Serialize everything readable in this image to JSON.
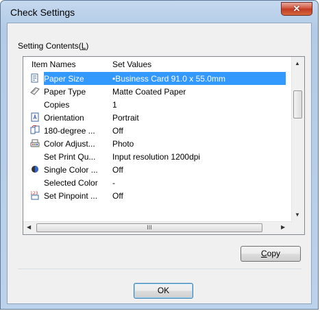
{
  "window": {
    "title": "Check Settings",
    "close_glyph": "✕"
  },
  "group": {
    "label_prefix": "Setting Contents(",
    "label_key": "L",
    "label_suffix": ")"
  },
  "list": {
    "columns": {
      "name": "Item Names",
      "value": "Set Values"
    },
    "rows": [
      {
        "icon": "paper-size-icon",
        "name": "Paper Size",
        "value": "•Business Card 91.0 x 55.0mm",
        "selected": true
      },
      {
        "icon": "paper-type-icon",
        "name": "Paper Type",
        "value": "Matte Coated Paper"
      },
      {
        "icon": "",
        "name": "Copies",
        "value": "1"
      },
      {
        "icon": "orientation-icon",
        "name": "Orientation",
        "value": "Portrait"
      },
      {
        "icon": "rotate-180-icon",
        "name": "180-degree ...",
        "value": "Off"
      },
      {
        "icon": "color-adjust-icon",
        "name": "Color Adjust...",
        "value": "Photo"
      },
      {
        "icon": "",
        "name": "Set Print Qu...",
        "value": "Input resolution 1200dpi"
      },
      {
        "icon": "single-color-icon",
        "name": "Single Color ...",
        "value": "Off"
      },
      {
        "icon": "",
        "name": "Selected Color",
        "value": "-"
      },
      {
        "icon": "pinpoint-icon",
        "name": "Set Pinpoint ...",
        "value": "Off"
      }
    ],
    "hscroll_grip": "III"
  },
  "buttons": {
    "copy_prefix": "",
    "copy_key": "C",
    "copy_suffix": "opy",
    "ok": "OK"
  },
  "colors": {
    "selection": "#3399ff",
    "window_frame": "#b9d1ea"
  }
}
